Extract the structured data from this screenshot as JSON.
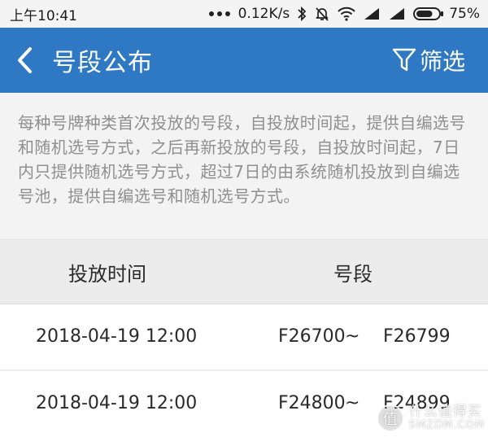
{
  "status_bar": {
    "time": "上午10:41",
    "network_speed": "0.12K/s",
    "battery": "75%",
    "battery_level": 0.75
  },
  "app_bar": {
    "title": "号段公布",
    "filter_label": "筛选"
  },
  "notice": {
    "text": "每种号牌种类首次投放的号段，自投放时间起，提供自编选号和随机选号方式，之后再新投放的号段，自投放时间起，7日内只提供随机选号方式，超过7日的由系统随机投放到自编选号池，提供自编选号和随机选号方式。"
  },
  "table": {
    "headers": {
      "time": "投放时间",
      "segment": "号段"
    },
    "rows": [
      {
        "time": "2018-04-19 12:00",
        "start": "F26700",
        "tilde": "~",
        "end": "F26799"
      },
      {
        "time": "2018-04-19 12:00",
        "start": "F24800",
        "tilde": "~",
        "end": "F24899"
      }
    ]
  },
  "watermark": {
    "logo_char": "值",
    "text_cn": "什么值得买",
    "text_en": "SMZDM.COM"
  },
  "colors": {
    "app_bar": "#2f78c4",
    "notice_text": "#8f8f8f",
    "table_header_bg": "#ececec"
  }
}
